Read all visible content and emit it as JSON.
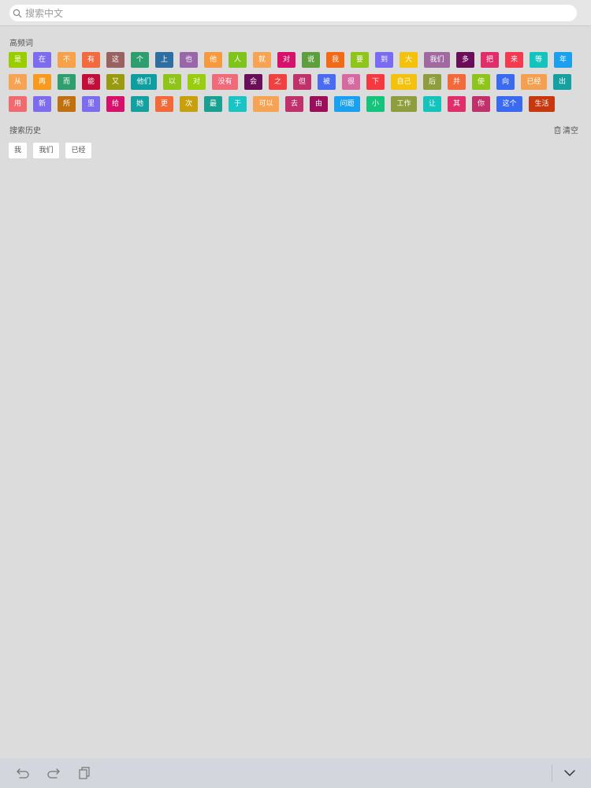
{
  "search": {
    "placeholder": "搜索中文",
    "value": ""
  },
  "hot_words": {
    "title": "高频词",
    "rows": [
      [
        {
          "text": "是",
          "color": "#9acd00"
        },
        {
          "text": "在",
          "color": "#7e6cf0"
        },
        {
          "text": "不",
          "color": "#f7a14a"
        },
        {
          "text": "有",
          "color": "#f26a3d"
        },
        {
          "text": "这",
          "color": "#9a6161"
        },
        {
          "text": "个",
          "color": "#2f9e6e"
        },
        {
          "text": "上",
          "color": "#2f6ea0"
        },
        {
          "text": "也",
          "color": "#9966aa"
        },
        {
          "text": "他",
          "color": "#f79a3e"
        },
        {
          "text": "人",
          "color": "#7fc41a"
        },
        {
          "text": "就",
          "color": "#f6a454"
        },
        {
          "text": "对",
          "color": "#d6116c"
        },
        {
          "text": "说",
          "color": "#5e9e3e"
        },
        {
          "text": "我",
          "color": "#f26a18"
        },
        {
          "text": "要",
          "color": "#8fc41a"
        },
        {
          "text": "到",
          "color": "#7a6cf2"
        },
        {
          "text": "大",
          "color": "#f4c20d"
        },
        {
          "text": "我们",
          "color": "#a06aa0"
        },
        {
          "text": "多",
          "color": "#6a0e5a"
        },
        {
          "text": "把",
          "color": "#e02e6a"
        },
        {
          "text": "来",
          "color": "#f43a50"
        },
        {
          "text": "等",
          "color": "#14c4bc"
        },
        {
          "text": "年",
          "color": "#1aa0ee"
        }
      ],
      [
        {
          "text": "从",
          "color": "#f6a454"
        },
        {
          "text": "再",
          "color": "#f79a1e"
        },
        {
          "text": "而",
          "color": "#2f9e6e"
        },
        {
          "text": "能",
          "color": "#c40e3a"
        },
        {
          "text": "又",
          "color": "#9a9a10"
        },
        {
          "text": "他们",
          "color": "#0e9ea0"
        },
        {
          "text": "以",
          "color": "#8fc41a"
        },
        {
          "text": "对",
          "color": "#9acd10"
        },
        {
          "text": "没有",
          "color": "#f06a7a"
        },
        {
          "text": "会",
          "color": "#6a0e5a"
        },
        {
          "text": "之",
          "color": "#f04040"
        },
        {
          "text": "但",
          "color": "#c0306a"
        },
        {
          "text": "被",
          "color": "#4a6af0"
        },
        {
          "text": "很",
          "color": "#d66aa0"
        },
        {
          "text": "下",
          "color": "#f43a40"
        },
        {
          "text": "自己",
          "color": "#f4c20d"
        },
        {
          "text": "后",
          "color": "#8e9e3e"
        },
        {
          "text": "并",
          "color": "#f36a3a"
        },
        {
          "text": "使",
          "color": "#8fc41a"
        },
        {
          "text": "向",
          "color": "#3a6af0"
        },
        {
          "text": "已经",
          "color": "#f4a050"
        },
        {
          "text": "出",
          "color": "#16a0a0"
        }
      ],
      [
        {
          "text": "用",
          "color": "#f06a70"
        },
        {
          "text": "新",
          "color": "#7e6cf0"
        },
        {
          "text": "所",
          "color": "#c0700e"
        },
        {
          "text": "里",
          "color": "#7e6cf0"
        },
        {
          "text": "给",
          "color": "#d6116c"
        },
        {
          "text": "她",
          "color": "#14a0a0"
        },
        {
          "text": "更",
          "color": "#f36a3a"
        },
        {
          "text": "次",
          "color": "#c8a00e"
        },
        {
          "text": "最",
          "color": "#1aa090"
        },
        {
          "text": "于",
          "color": "#1ac4c4"
        },
        {
          "text": "可以",
          "color": "#f6a454"
        },
        {
          "text": "去",
          "color": "#c0306a"
        },
        {
          "text": "由",
          "color": "#9a0e5a"
        },
        {
          "text": "问题",
          "color": "#1aa0ee"
        },
        {
          "text": "小",
          "color": "#14c47a"
        },
        {
          "text": "工作",
          "color": "#8e9e3e"
        },
        {
          "text": "让",
          "color": "#14c4bc"
        },
        {
          "text": "其",
          "color": "#e02e6a"
        },
        {
          "text": "你",
          "color": "#c0306a"
        },
        {
          "text": "这个",
          "color": "#3a6af0"
        },
        {
          "text": "生活",
          "color": "#c8380e"
        }
      ]
    ]
  },
  "history": {
    "title": "搜索历史",
    "clear_label": "清空",
    "items": [
      "我",
      "我们",
      "已经"
    ]
  },
  "icons": {
    "search": "search-icon",
    "trash": "trash-icon",
    "undo": "undo-icon",
    "redo": "redo-icon",
    "paste": "clipboard-icon",
    "dismiss": "chevron-down-icon"
  }
}
